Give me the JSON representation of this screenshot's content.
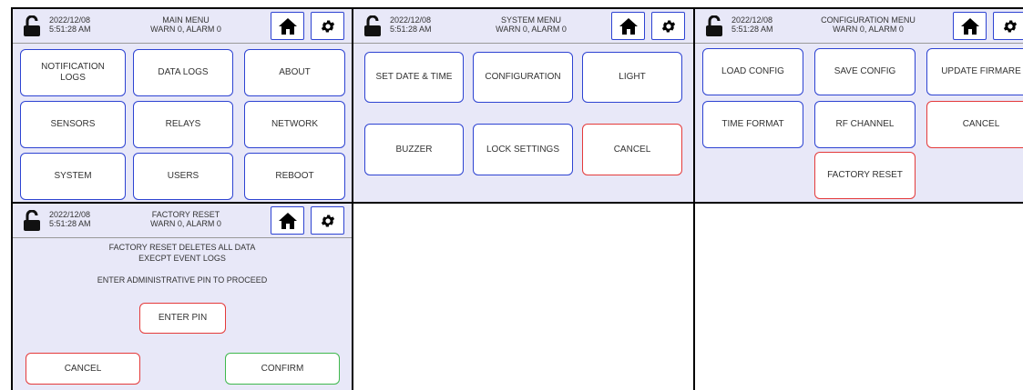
{
  "status": {
    "date": "2022/12/08",
    "time": "5:51:28 AM",
    "warnings": "WARN 0, ALARM 0"
  },
  "icons": {
    "lock": "unlock-icon",
    "home": "home-icon",
    "settings": "gear-icon"
  },
  "colors": {
    "background": "#e8e8f8",
    "button_border": "#2d43d2",
    "cancel_border": "#e43a3a",
    "confirm_border": "#3fb84d"
  },
  "main_menu": {
    "title": "MAIN MENU",
    "buttons": [
      "NOTIFICATION\nLOGS",
      "DATA LOGS",
      "ABOUT",
      "SENSORS",
      "RELAYS",
      "NETWORK",
      "SYSTEM",
      "USERS",
      "REBOOT"
    ]
  },
  "system_menu": {
    "title": "SYSTEM MENU",
    "buttons": [
      "SET DATE & TIME",
      "CONFIGURATION",
      "LIGHT",
      "BUZZER",
      "LOCK SETTINGS",
      "CANCEL"
    ]
  },
  "config_menu": {
    "title": "CONFIGURATION MENU",
    "buttons": [
      "LOAD CONFIG",
      "SAVE CONFIG",
      "UPDATE FIRMARE",
      "TIME FORMAT",
      "RF CHANNEL",
      "CANCEL",
      "FACTORY RESET"
    ]
  },
  "factory_reset": {
    "title": "FACTORY RESET",
    "message1": "FACTORY RESET DELETES ALL DATA",
    "message2": "EXECPT EVENT LOGS",
    "message3": "ENTER ADMINISTRATIVE PIN TO PROCEED",
    "enter_pin": "ENTER PIN",
    "cancel": "CANCEL",
    "confirm": "CONFIRM"
  }
}
